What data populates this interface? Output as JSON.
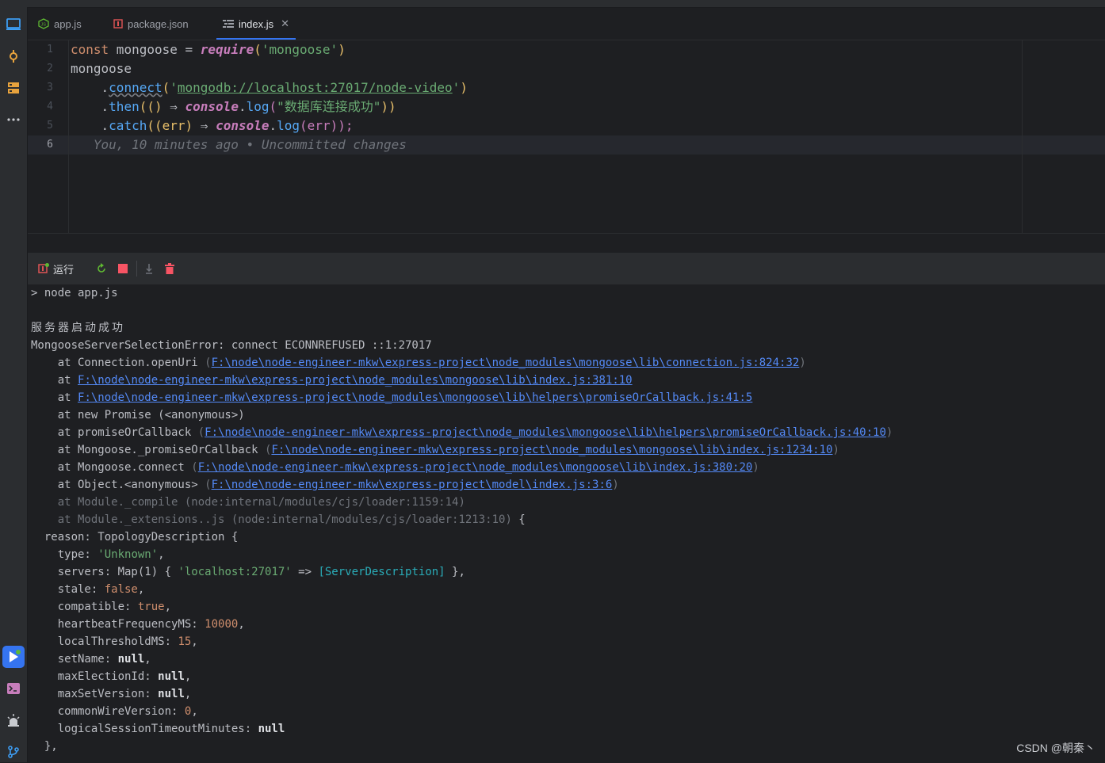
{
  "tabs": [
    {
      "label": "app.js",
      "icon": "js-file-icon",
      "active": false
    },
    {
      "label": "package.json",
      "icon": "json-file-icon",
      "active": false
    },
    {
      "label": "index.js",
      "icon": "structure-file-icon",
      "active": true
    }
  ],
  "editor": {
    "line_numbers": [
      "1",
      "2",
      "3",
      "4",
      "5",
      "6"
    ],
    "current_line": "6",
    "lines": [
      {
        "t1": "const",
        "t2": " mongoose ",
        "t3": "=",
        "t4": " ",
        "t5": "require",
        "t6": "(",
        "t7": "'mongoose'",
        "t8": ")"
      },
      {
        "t1": "mongoose"
      },
      {
        "t1": "    .",
        "t2": "connect",
        "t3": "(",
        "t4": "'",
        "t5": "mongodb://localhost:27017/node-video",
        "t6": "'",
        "t7": ")"
      },
      {
        "t1": "    .",
        "t2": "then",
        "t3": "(() ",
        "t4": "⇒",
        "t5": " ",
        "t6": "console",
        "t7": ".",
        "t8": "log",
        "t9": "(",
        "t10": "\"数据库连接成功\"",
        "t11": "))"
      },
      {
        "t1": "    .",
        "t2": "catch",
        "t3": "((err) ",
        "t4": "⇒",
        "t5": " ",
        "t6": "console",
        "t7": ".",
        "t8": "log",
        "t9": "(err));"
      },
      {
        "blame": "   You, 10 minutes ago • Uncommitted changes"
      }
    ]
  },
  "run_panel": {
    "title": "运行",
    "tools": [
      "rerun-icon",
      "stop-icon",
      "scroll-to-end-icon",
      "clear-all-icon"
    ]
  },
  "console": {
    "cmd": "> node app.js",
    "server_ok": "服务器启动成功",
    "error": "MongooseServerSelectionError: connect ECONNREFUSED ::1:27017",
    "trace": [
      {
        "pre": "    at Connection.openUri ",
        "open": "(",
        "link": "F:\\node\\node-engineer-mkw\\express-project\\node_modules\\mongoose\\lib\\connection.js:824:32",
        "close": ")"
      },
      {
        "pre": "    at ",
        "open": "",
        "link": "F:\\node\\node-engineer-mkw\\express-project\\node_modules\\mongoose\\lib\\index.js:381:10",
        "close": ""
      },
      {
        "pre": "    at ",
        "open": "",
        "link": "F:\\node\\node-engineer-mkw\\express-project\\node_modules\\mongoose\\lib\\helpers\\promiseOrCallback.js:41:5",
        "close": ""
      },
      {
        "pre": "    at new Promise (<anonymous>)",
        "open": "",
        "link": "",
        "close": ""
      },
      {
        "pre": "    at promiseOrCallback ",
        "open": "(",
        "link": "F:\\node\\node-engineer-mkw\\express-project\\node_modules\\mongoose\\lib\\helpers\\promiseOrCallback.js:40:10",
        "close": ")"
      },
      {
        "pre": "    at Mongoose._promiseOrCallback ",
        "open": "(",
        "link": "F:\\node\\node-engineer-mkw\\express-project\\node_modules\\mongoose\\lib\\index.js:1234:10",
        "close": ")"
      },
      {
        "pre": "    at Mongoose.connect ",
        "open": "(",
        "link": "F:\\node\\node-engineer-mkw\\express-project\\node_modules\\mongoose\\lib\\index.js:380:20",
        "close": ")"
      },
      {
        "pre": "    at Object.<anonymous> ",
        "open": "(",
        "link": "F:\\node\\node-engineer-mkw\\express-project\\model\\index.js:3:6",
        "close": ")"
      }
    ],
    "dim_trace": [
      {
        "text": "    at Module._compile (node:internal/modules/cjs/loader:1159:14)",
        "tail": ""
      },
      {
        "text": "    at Module._extensions..js (node:internal/modules/cjs/loader:1213:10)",
        "tail": " {"
      }
    ],
    "reason": "  reason: TopologyDescription {",
    "props": [
      {
        "key": "    type: ",
        "val": "'Unknown'",
        "kind": "cstr",
        "tail": ","
      },
      {
        "key": "    servers: Map(1) { ",
        "val": "'localhost:27017'",
        "kind": "cstr",
        "tail": " => ",
        "extra": "[ServerDescription]",
        "extra_kind": "ccls",
        "tail2": " },"
      },
      {
        "key": "    stale: ",
        "val": "false",
        "kind": "cbool",
        "tail": ","
      },
      {
        "key": "    compatible: ",
        "val": "true",
        "kind": "cbool",
        "tail": ","
      },
      {
        "key": "    heartbeatFrequencyMS: ",
        "val": "10000",
        "kind": "cnum2",
        "tail": ","
      },
      {
        "key": "    localThresholdMS: ",
        "val": "15",
        "kind": "cnum2",
        "tail": ","
      },
      {
        "key": "    setName: ",
        "val": "null",
        "kind": "bold",
        "tail": ","
      },
      {
        "key": "    maxElectionId: ",
        "val": "null",
        "kind": "bold",
        "tail": ","
      },
      {
        "key": "    maxSetVersion: ",
        "val": "null",
        "kind": "bold",
        "tail": ","
      },
      {
        "key": "    commonWireVersion: ",
        "val": "0",
        "kind": "cnum2",
        "tail": ","
      },
      {
        "key": "    logicalSessionTimeoutMinutes: ",
        "val": "null",
        "kind": "bold",
        "tail": ""
      }
    ],
    "closing": "  },"
  },
  "watermark": "CSDN @朝秦丶",
  "colors": {
    "accent": "#3574f0",
    "link": "#548af7",
    "string": "#6aab73",
    "keyword": "#cf8e6d",
    "error_red": "#f75464"
  }
}
